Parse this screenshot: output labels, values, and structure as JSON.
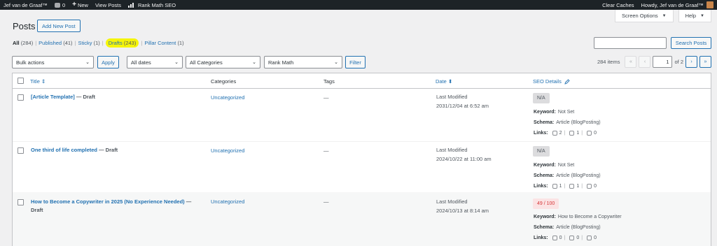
{
  "adminbar": {
    "site_name": "Jef van de Graaf™",
    "comments_count": "0",
    "new_label": "New",
    "view_posts": "View Posts",
    "rank_math": "Rank Math SEO",
    "clear_caches": "Clear Caches",
    "howdy": "Howdy, Jef van de Graaf™"
  },
  "screen_options": {
    "screen_options": "Screen Options",
    "help": "Help"
  },
  "page": {
    "title": "Posts",
    "add_new": "Add New Post"
  },
  "views": [
    {
      "label": "All",
      "count": "(284)"
    },
    {
      "label": "Published",
      "count": "(41)"
    },
    {
      "label": "Sticky",
      "count": "(1)"
    },
    {
      "label": "Drafts",
      "count": "(243)"
    },
    {
      "label": "Pillar Content",
      "count": "(1)"
    }
  ],
  "search": {
    "button": "Search Posts",
    "value": ""
  },
  "tablenav": {
    "bulk_actions": "Bulk actions",
    "apply": "Apply",
    "dates": "All dates",
    "categories": "All Categories",
    "rank_math": "Rank Math",
    "filter": "Filter",
    "items": "284 items",
    "first": "«",
    "prev": "‹",
    "current_page": "1",
    "of_pages": "of 2",
    "next": "›",
    "last": "»"
  },
  "columns": {
    "title": "Title",
    "categories": "Categories",
    "tags": "Tags",
    "date": "Date",
    "seo": "SEO Details"
  },
  "rows": [
    {
      "title": "[Article Template]",
      "state": " — Draft",
      "category": "Uncategorized",
      "tags": "—",
      "date_label": "Last Modified",
      "date_value": "2031/12/04 at 6:52 am",
      "score": "N/A",
      "keyword_label": "Keyword:",
      "keyword": "Not Set",
      "schema_label": "Schema:",
      "schema": "Article (BlogPosting)",
      "links_label": "Links:",
      "internal": "2",
      "external": "1",
      "incoming": "0"
    },
    {
      "title": "One third of life completed",
      "state": " — Draft",
      "category": "Uncategorized",
      "tags": "—",
      "date_label": "Last Modified",
      "date_value": "2024/10/22 at 11:00 am",
      "score": "N/A",
      "keyword_label": "Keyword:",
      "keyword": "Not Set",
      "schema_label": "Schema:",
      "schema": "Article (BlogPosting)",
      "links_label": "Links:",
      "internal": "1",
      "external": "1",
      "incoming": "0"
    },
    {
      "title": "How to Become a Copywriter in 2025 (No Experience Needed)",
      "state": " —",
      "state2": "Draft",
      "category": "Uncategorized",
      "tags": "—",
      "date_label": "Last Modified",
      "date_value": "2024/10/13 at 8:14 am",
      "score": "49 / 100",
      "keyword_label": "Keyword:",
      "keyword": "How to Become a Copywriter",
      "schema_label": "Schema:",
      "schema": "Article (BlogPosting)",
      "links_label": "Links:",
      "internal": "0",
      "external": "0",
      "incoming": "0"
    }
  ],
  "colors": {
    "accent": "#2271b1",
    "adminbar": "#1d2327",
    "highlight": "#f5f50a",
    "bad_score_bg": "#fbe3e4",
    "bad_score_text": "#d63638"
  }
}
